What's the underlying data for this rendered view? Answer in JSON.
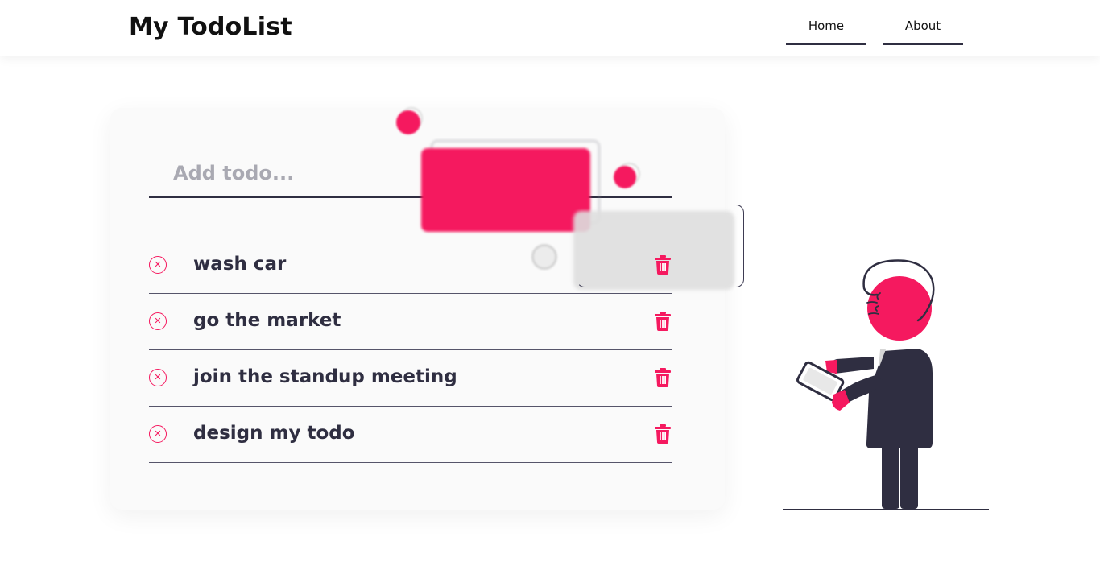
{
  "header": {
    "brand": "My TodoList",
    "nav": [
      {
        "label": "Home"
      },
      {
        "label": "About"
      }
    ]
  },
  "todo_input": {
    "placeholder": "Add todo...",
    "value": ""
  },
  "todos": [
    {
      "text": "wash car"
    },
    {
      "text": "go the market"
    },
    {
      "text": "join the standup meeting"
    },
    {
      "text": "design my todo"
    }
  ],
  "colors": {
    "accent": "#f5195f",
    "dark": "#2f2e41",
    "card": "#fafafa"
  },
  "icons": {
    "remove": "circle-x-icon",
    "delete": "trash-icon"
  }
}
